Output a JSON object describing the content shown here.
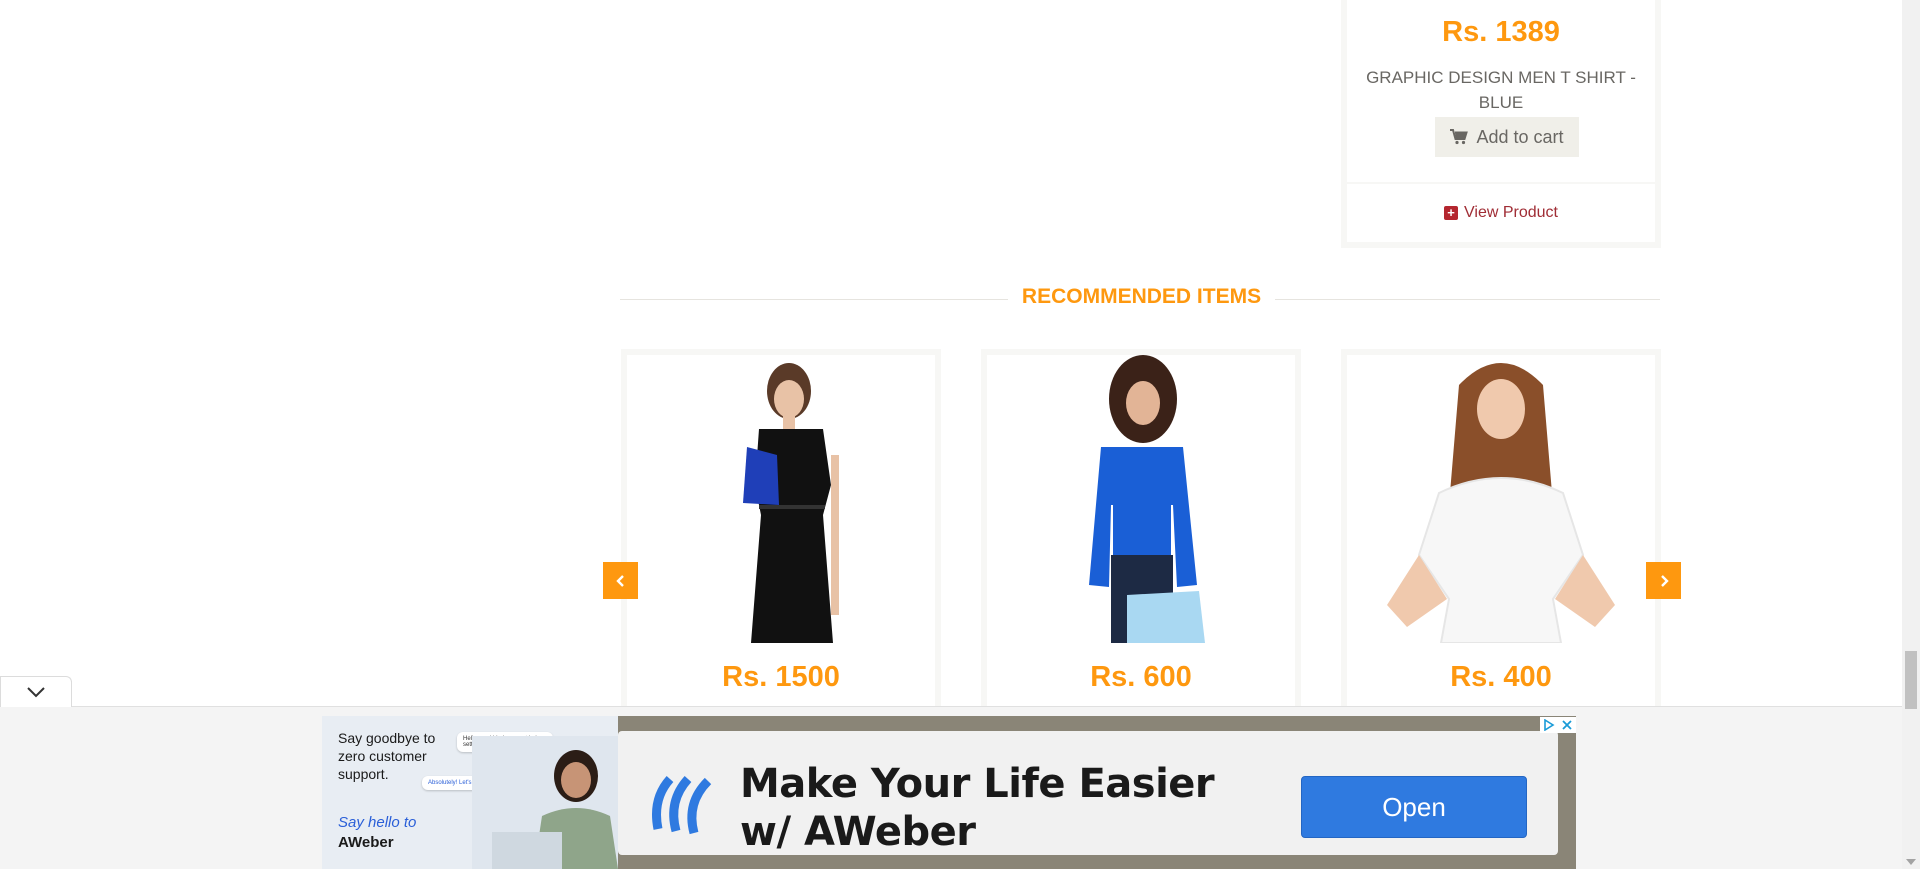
{
  "top_product": {
    "price": "Rs. 1389",
    "name": "GRAPHIC DESIGN MEN T SHIRT - BLUE",
    "add_to_cart": "Add to cart",
    "view_product": "View Product"
  },
  "recommended": {
    "heading": "RECOMMENDED ITEMS",
    "items": [
      {
        "price": "Rs. 1500"
      },
      {
        "price": "Rs. 600"
      },
      {
        "price": "Rs. 400"
      }
    ]
  },
  "ad": {
    "left_text": "Say goodbye to zero customer support.",
    "bubble_1": "Hello, could I please get help setting up my first campaign?",
    "bubble_2": "Absolutely! Let's get started!",
    "hello": "Say hello to",
    "brand": "AWeber",
    "headline": "Make Your Life Easier w/ AWeber",
    "cta": "Open"
  },
  "colors": {
    "accent": "#fe980f",
    "link": "#a02d35",
    "ad_button": "#2f7ae0"
  }
}
